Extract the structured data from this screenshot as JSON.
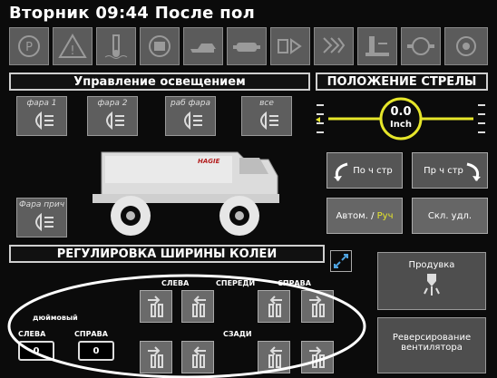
{
  "header": {
    "title": "Вторник 09:44 После пол"
  },
  "warning_icons": [
    "parking-brake-icon",
    "warning-triangle-icon",
    "coolant-temp-icon",
    "engine-icon",
    "oil-pressure-icon",
    "hydraulic-icon",
    "transmission-icon",
    "filter-icon",
    "hydraulic-pressure-icon",
    "engine-fault-icon",
    "air-filter-icon"
  ],
  "lighting": {
    "title": "Управление освещением",
    "buttons": {
      "front1": "фара 1",
      "front2": "фара 2",
      "work": "раб фара",
      "all": "все",
      "rear": "Фара прич"
    },
    "vehicle_logo": "HAGIE"
  },
  "boom": {
    "title": "ПОЛОЖЕНИЕ СТРЕЛЫ",
    "value": "0.0",
    "unit": "Inch",
    "btn_left": "По ч стр",
    "btn_right": "Пр ч стр",
    "mode_auto": "Автом.",
    "mode_sep": "/",
    "mode_manual": "Руч",
    "fold_btn": "Скл. удл."
  },
  "track": {
    "title": "РЕГУЛИРОВКА ШИРИНЫ КОЛЕИ",
    "col_left": "СЛЕВА",
    "col_front": "СПЕРЕДИ",
    "col_right": "СПРАВА",
    "row_rear": "СЗАДИ",
    "units": "дюймовый",
    "left_label": "СЛЕВА",
    "right_label": "СПРАВА",
    "left_value": "0",
    "right_value": "0"
  },
  "side": {
    "purge": "Продувка",
    "reverse_fan_1": "Реверсирование",
    "reverse_fan_2": "вентилятора"
  },
  "colors": {
    "accent_yellow": "#e6e62a",
    "panel_gray": "#5e5e5e"
  }
}
